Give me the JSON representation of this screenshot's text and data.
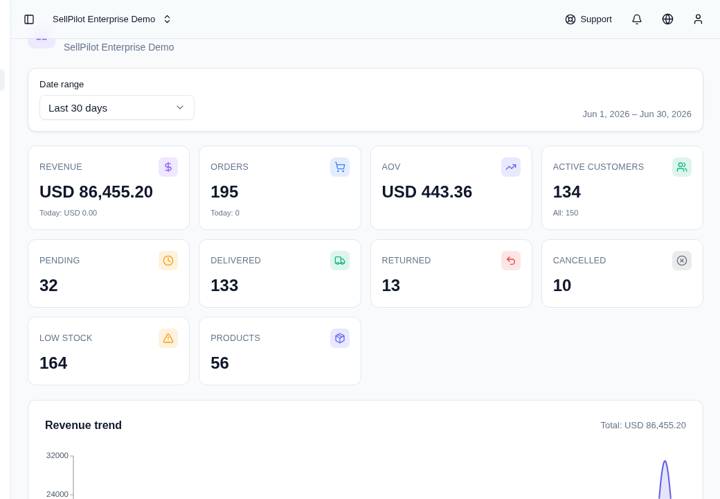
{
  "topbar": {
    "workspace": "SellPilot Enterprise Demo",
    "support": "Support"
  },
  "page": {
    "subtitle": "SellPilot Enterprise Demo"
  },
  "filters": {
    "label": "Date range",
    "select_value": "Last 30 days",
    "range_text": "Jun 1, 2026 – Jun 30, 2026"
  },
  "cards": [
    {
      "kind": "revenue",
      "label": "REVENUE",
      "value": "USD 86,455.20",
      "note": "Today: USD 0.00",
      "color": "#8b5cf6"
    },
    {
      "kind": "orders",
      "label": "ORDERS",
      "value": "195",
      "note": "Today: 0",
      "color": "#3b82f6"
    },
    {
      "kind": "aov",
      "label": "AOV",
      "value": "USD 443.36",
      "color": "#6366f1"
    },
    {
      "kind": "customers",
      "label": "ACTIVE CUSTOMERS",
      "value": "134",
      "note": "All: 150",
      "color": "#10b981"
    },
    {
      "kind": "pending",
      "label": "PENDING",
      "value": "32",
      "color": "#f59e0b"
    },
    {
      "kind": "delivered",
      "label": "DELIVERED",
      "value": "133",
      "color": "#10b981"
    },
    {
      "kind": "returned",
      "label": "RETURNED",
      "value": "13",
      "color": "#ef4444"
    },
    {
      "kind": "cancelled",
      "label": "CANCELLED",
      "value": "10",
      "color": "#6b7280"
    },
    {
      "kind": "low_stock",
      "label": "LOW STOCK",
      "value": "164",
      "color": "#f59e0b"
    },
    {
      "kind": "products",
      "label": "PRODUCTS",
      "value": "56",
      "color": "#6366f1"
    }
  ],
  "revenue_trend": {
    "title": "Revenue trend",
    "total": "Total: USD 86,455.20",
    "y_axis_labels": [
      "32000",
      "24000"
    ]
  }
}
